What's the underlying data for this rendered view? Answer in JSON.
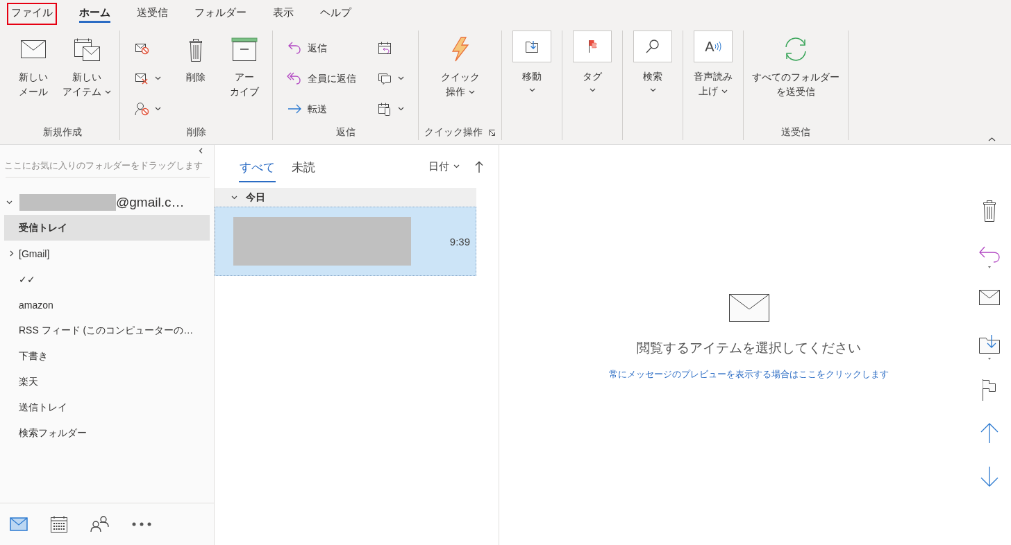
{
  "menu_tabs": [
    {
      "label": "ファイル",
      "selected": false,
      "highlighted": true
    },
    {
      "label": "ホーム",
      "selected": true,
      "highlighted": false
    },
    {
      "label": "送受信",
      "selected": false,
      "highlighted": false
    },
    {
      "label": "フォルダー",
      "selected": false,
      "highlighted": false
    },
    {
      "label": "表示",
      "selected": false,
      "highlighted": false
    },
    {
      "label": "ヘルプ",
      "selected": false,
      "highlighted": false
    }
  ],
  "ribbon": {
    "groups": [
      {
        "label": "新規作成",
        "items": [
          {
            "kind": "large",
            "lines": [
              "新しい",
              "メール"
            ],
            "dropdown": false
          },
          {
            "kind": "large",
            "lines": [
              "新しい",
              "アイテム"
            ],
            "dropdown": true
          }
        ]
      },
      {
        "label": "削除",
        "items": [
          {
            "kind": "stack",
            "buttons": [
              {
                "dropdown": false
              },
              {
                "dropdown": true
              },
              {
                "dropdown": true
              }
            ]
          },
          {
            "kind": "large",
            "lines": [
              "削除"
            ],
            "dropdown": false
          },
          {
            "kind": "large",
            "lines": [
              "アー",
              "カイブ"
            ],
            "dropdown": false
          }
        ]
      },
      {
        "label": "返信",
        "items": [
          {
            "kind": "stack",
            "buttons": [
              {
                "label": "返信",
                "dropdown": false
              },
              {
                "label": "全員に返信",
                "dropdown": false
              },
              {
                "label": "転送",
                "dropdown": false
              }
            ]
          },
          {
            "kind": "stack",
            "buttons": [
              {
                "dropdown": false
              },
              {
                "dropdown": true
              },
              {
                "dropdown": true
              }
            ]
          }
        ]
      },
      {
        "label": "クイック操作",
        "launcher": true,
        "items": [
          {
            "kind": "large",
            "lines": [
              "クイック",
              "操作"
            ],
            "dropdown": true
          }
        ]
      },
      {
        "items": [
          {
            "kind": "boxed",
            "lines": [
              "移動"
            ],
            "dropdown": true
          }
        ]
      },
      {
        "items": [
          {
            "kind": "boxed",
            "lines": [
              "タグ"
            ],
            "dropdown": true
          }
        ]
      },
      {
        "items": [
          {
            "kind": "boxed",
            "lines": [
              "検索"
            ],
            "dropdown": true
          }
        ]
      },
      {
        "items": [
          {
            "kind": "boxed",
            "lines": [
              "音声読み",
              "上げ"
            ],
            "dropdown": true,
            "glyph": "A"
          }
        ]
      },
      {
        "label": "送受信",
        "items": [
          {
            "kind": "large",
            "lines": [
              "すべてのフォルダー",
              "を送受信"
            ],
            "dropdown": false
          }
        ]
      }
    ]
  },
  "folder_pane": {
    "favorites_hint": "ここにお気に入りのフォルダーをドラッグします",
    "account": {
      "label": "@gmail.c…",
      "expanded": true,
      "children": [
        {
          "label": "受信トレイ",
          "selected": true
        },
        {
          "label": "[Gmail]",
          "selected": false,
          "expanded": false
        },
        {
          "label": "✓✓",
          "selected": false
        },
        {
          "label": "amazon",
          "selected": false
        },
        {
          "label": "RSS フィード (このコンピューターの…",
          "selected": false
        },
        {
          "label": "下書き",
          "selected": false
        },
        {
          "label": "楽天",
          "selected": false
        },
        {
          "label": "送信トレイ",
          "selected": false
        },
        {
          "label": "検索フォルダー",
          "selected": false
        }
      ]
    },
    "nav": [
      {
        "selected": true
      },
      {
        "selected": false
      },
      {
        "selected": false
      },
      {
        "selected": false
      }
    ]
  },
  "message_list": {
    "tabs": [
      {
        "label": "すべて",
        "selected": true
      },
      {
        "label": "未読",
        "selected": false
      }
    ],
    "sort": "日付",
    "groups": [
      {
        "label": "今日",
        "expanded": true,
        "messages": [
          {
            "time": "9:39",
            "selected": true
          }
        ]
      }
    ]
  },
  "reading_pane": {
    "message": "閲覧するアイテムを選択してください",
    "link": "常にメッセージのプレビューを表示する場合はここをクリックします"
  }
}
